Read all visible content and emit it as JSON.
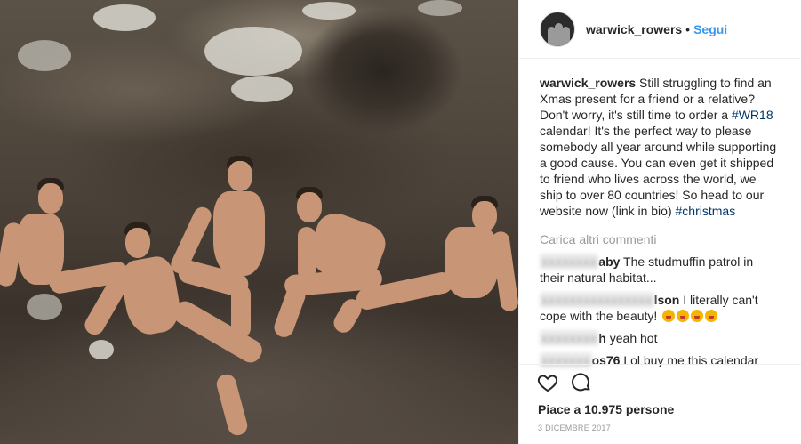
{
  "header": {
    "username": "warwick_rowers",
    "separator": "•",
    "follow_label": "Segui"
  },
  "caption": {
    "username": "warwick_rowers",
    "text_1": " Still struggling to find an Xmas present for a friend or a relative? Don't worry, it's still time to order a ",
    "hashtag_1": "#WR18",
    "text_2": " calendar! It's the perfect way to please somebody all year around while supporting a good cause. You can even get it shipped to friend who lives across the world, we ship to over 80 countries! So head to our website now (link in bio) ",
    "hashtag_2": "#christmas"
  },
  "load_more_label": "Carica altri commenti",
  "comments": [
    {
      "user_visible": "aby",
      "text": " The studmuffin patrol in their natural habitat..."
    },
    {
      "user_visible": "lson",
      "text": " I literally can't cope with the beauty! ",
      "emojis": 4
    },
    {
      "user_visible": "h",
      "text": " yeah hot"
    },
    {
      "user_visible": "os76",
      "text": " Lol buy me this calendar"
    }
  ],
  "likes_label": "Piace a 10.975 persone",
  "date_label": "3 DICEMBRE 2017",
  "icons": {
    "like": "heart-icon",
    "comment": "comment-bubble-icon"
  }
}
